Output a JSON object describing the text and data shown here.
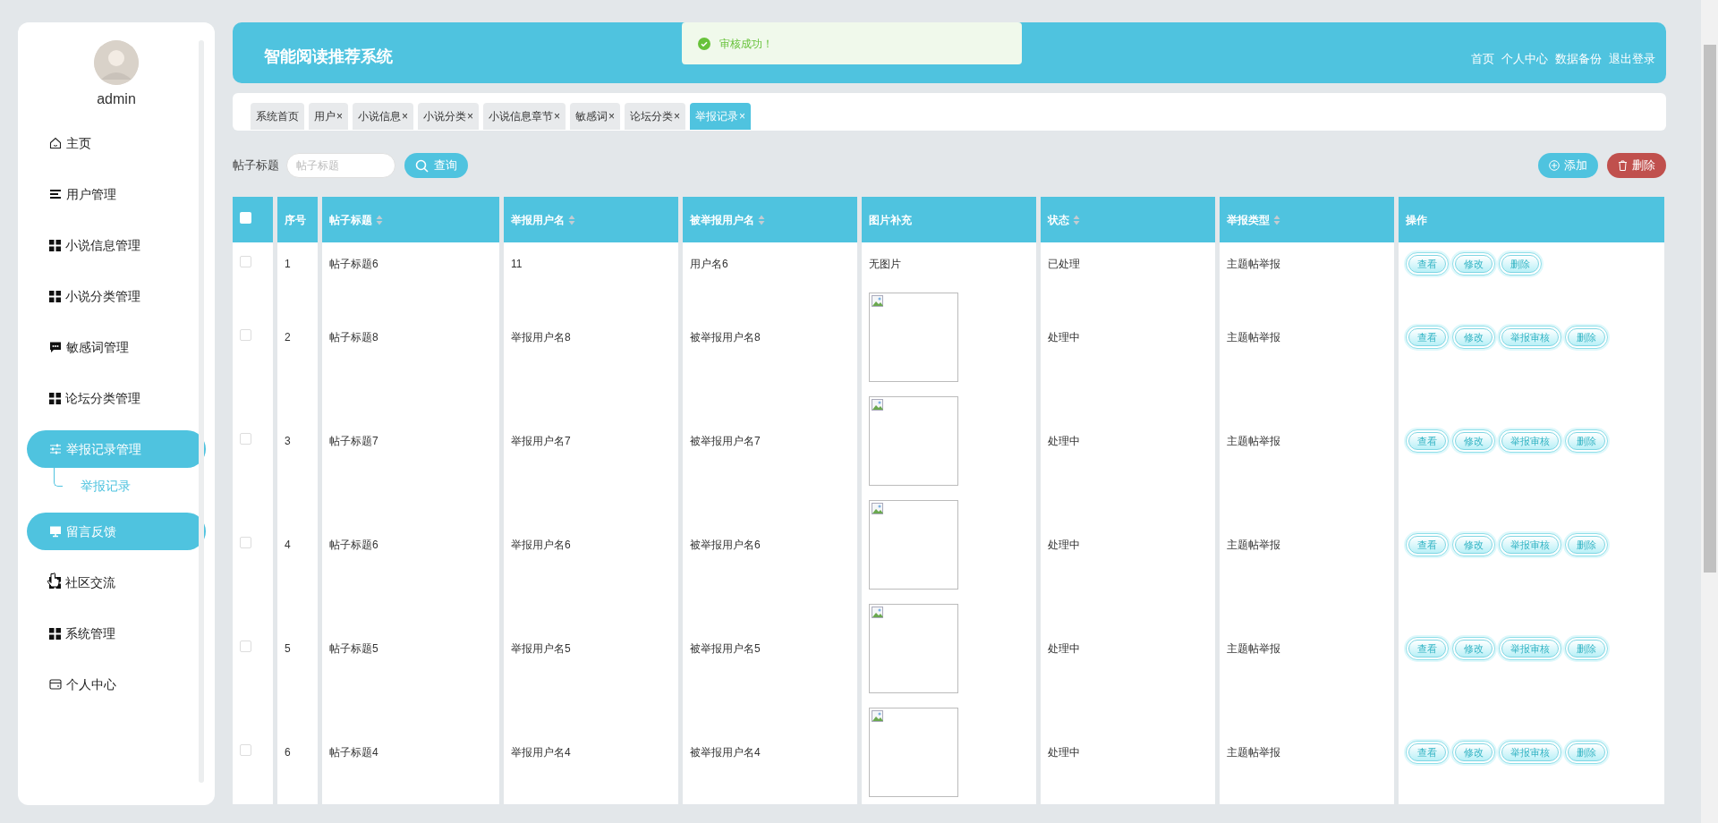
{
  "sidebar": {
    "user": {
      "name": "admin"
    },
    "items": [
      {
        "label": "主页",
        "active": false
      },
      {
        "label": "用户管理",
        "active": false
      },
      {
        "label": "小说信息管理",
        "active": false
      },
      {
        "label": "小说分类管理",
        "active": false
      },
      {
        "label": "敏感词管理",
        "active": false
      },
      {
        "label": "论坛分类管理",
        "active": false
      },
      {
        "label": "举报记录管理",
        "active": true,
        "expanded": true,
        "children": [
          {
            "label": "举报记录",
            "selected": true
          }
        ]
      },
      {
        "label": "留言反馈",
        "active": true
      },
      {
        "label": "社区交流",
        "active": false
      },
      {
        "label": "系统管理",
        "active": false
      },
      {
        "label": "个人中心",
        "active": false
      }
    ]
  },
  "header": {
    "title": "智能阅读推荐系统",
    "links": [
      "首页",
      "个人中心",
      "数据备份",
      "退出登录"
    ]
  },
  "toast": {
    "message": "审核成功！"
  },
  "tabs": [
    {
      "label": "系统首页",
      "closable": false,
      "selected": false
    },
    {
      "label": "用户",
      "closable": true,
      "selected": false
    },
    {
      "label": "小说信息",
      "closable": true,
      "selected": false
    },
    {
      "label": "小说分类",
      "closable": true,
      "selected": false
    },
    {
      "label": "小说信息章节",
      "closable": true,
      "selected": false
    },
    {
      "label": "敏感词",
      "closable": true,
      "selected": false
    },
    {
      "label": "论坛分类",
      "closable": true,
      "selected": false
    },
    {
      "label": "举报记录",
      "closable": true,
      "selected": true
    }
  ],
  "close_glyph": "×",
  "search": {
    "label": "帖子标题",
    "placeholder": "帖子标题",
    "button": "查询"
  },
  "actions": {
    "add": "添加",
    "delete": "删除"
  },
  "table": {
    "all_checked": false,
    "columns": [
      {
        "label": "序号",
        "sortable": false
      },
      {
        "label": "帖子标题",
        "sortable": true
      },
      {
        "label": "举报用户名",
        "sortable": true
      },
      {
        "label": "被举报用户名",
        "sortable": true
      },
      {
        "label": "图片补充",
        "sortable": false
      },
      {
        "label": "状态",
        "sortable": true
      },
      {
        "label": "举报类型",
        "sortable": true
      },
      {
        "label": "操作",
        "sortable": false
      }
    ],
    "rows": [
      {
        "checked": false,
        "index": "1",
        "title": "帖子标题6",
        "reporter": "11",
        "reported": "用户名6",
        "image": {
          "kind": "text",
          "text": "无图片"
        },
        "status": "已处理",
        "type": "主题帖举报",
        "actions": [
          "查看",
          "修改",
          "删除"
        ]
      },
      {
        "checked": false,
        "index": "2",
        "title": "帖子标题8",
        "reporter": "举报用户名8",
        "reported": "被举报用户名8",
        "image": {
          "kind": "broken"
        },
        "status": "处理中",
        "type": "主题帖举报",
        "actions": [
          "查看",
          "修改",
          "举报审核",
          "删除"
        ]
      },
      {
        "checked": false,
        "index": "3",
        "title": "帖子标题7",
        "reporter": "举报用户名7",
        "reported": "被举报用户名7",
        "image": {
          "kind": "broken"
        },
        "status": "处理中",
        "type": "主题帖举报",
        "actions": [
          "查看",
          "修改",
          "举报审核",
          "删除"
        ]
      },
      {
        "checked": false,
        "index": "4",
        "title": "帖子标题6",
        "reporter": "举报用户名6",
        "reported": "被举报用户名6",
        "image": {
          "kind": "broken"
        },
        "status": "处理中",
        "type": "主题帖举报",
        "actions": [
          "查看",
          "修改",
          "举报审核",
          "删除"
        ]
      },
      {
        "checked": false,
        "index": "5",
        "title": "帖子标题5",
        "reporter": "举报用户名5",
        "reported": "被举报用户名5",
        "image": {
          "kind": "broken"
        },
        "status": "处理中",
        "type": "主题帖举报",
        "actions": [
          "查看",
          "修改",
          "举报审核",
          "删除"
        ]
      },
      {
        "checked": false,
        "index": "6",
        "title": "帖子标题4",
        "reporter": "举报用户名4",
        "reported": "被举报用户名4",
        "image": {
          "kind": "broken"
        },
        "status": "处理中",
        "type": "主题帖举报",
        "actions": [
          "查看",
          "修改",
          "举报审核",
          "删除"
        ]
      }
    ]
  }
}
